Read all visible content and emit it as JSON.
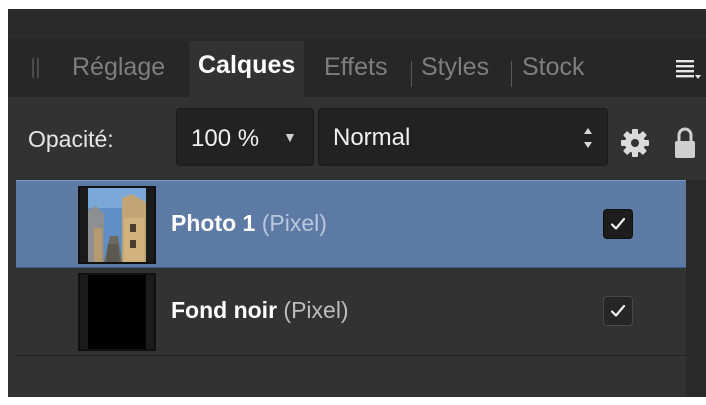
{
  "tabs": [
    {
      "label": "Réglage",
      "active": false
    },
    {
      "label": "Calques",
      "active": true
    },
    {
      "label": "Effets",
      "active": false
    },
    {
      "label": "Styles",
      "active": false
    },
    {
      "label": "Stock",
      "active": false
    }
  ],
  "toolbar": {
    "opacity_label": "Opacité:",
    "opacity_value": "100 %",
    "blend_mode": "Normal"
  },
  "layers": [
    {
      "name": "Photo 1",
      "type": "(Pixel)",
      "visible": true,
      "selected": true
    },
    {
      "name": "Fond noir",
      "type": "(Pixel)",
      "visible": true,
      "selected": false
    }
  ],
  "colors": {
    "panel_bg": "#323232",
    "selected_row": "#5d7aa4",
    "active_tab_text": "#ffffff",
    "inactive_tab_text": "#7e7e7e"
  },
  "icons": [
    "grip-icon",
    "panel-menu-icon",
    "settings-gear-icon",
    "lock-icon",
    "checkmark-icon"
  ]
}
